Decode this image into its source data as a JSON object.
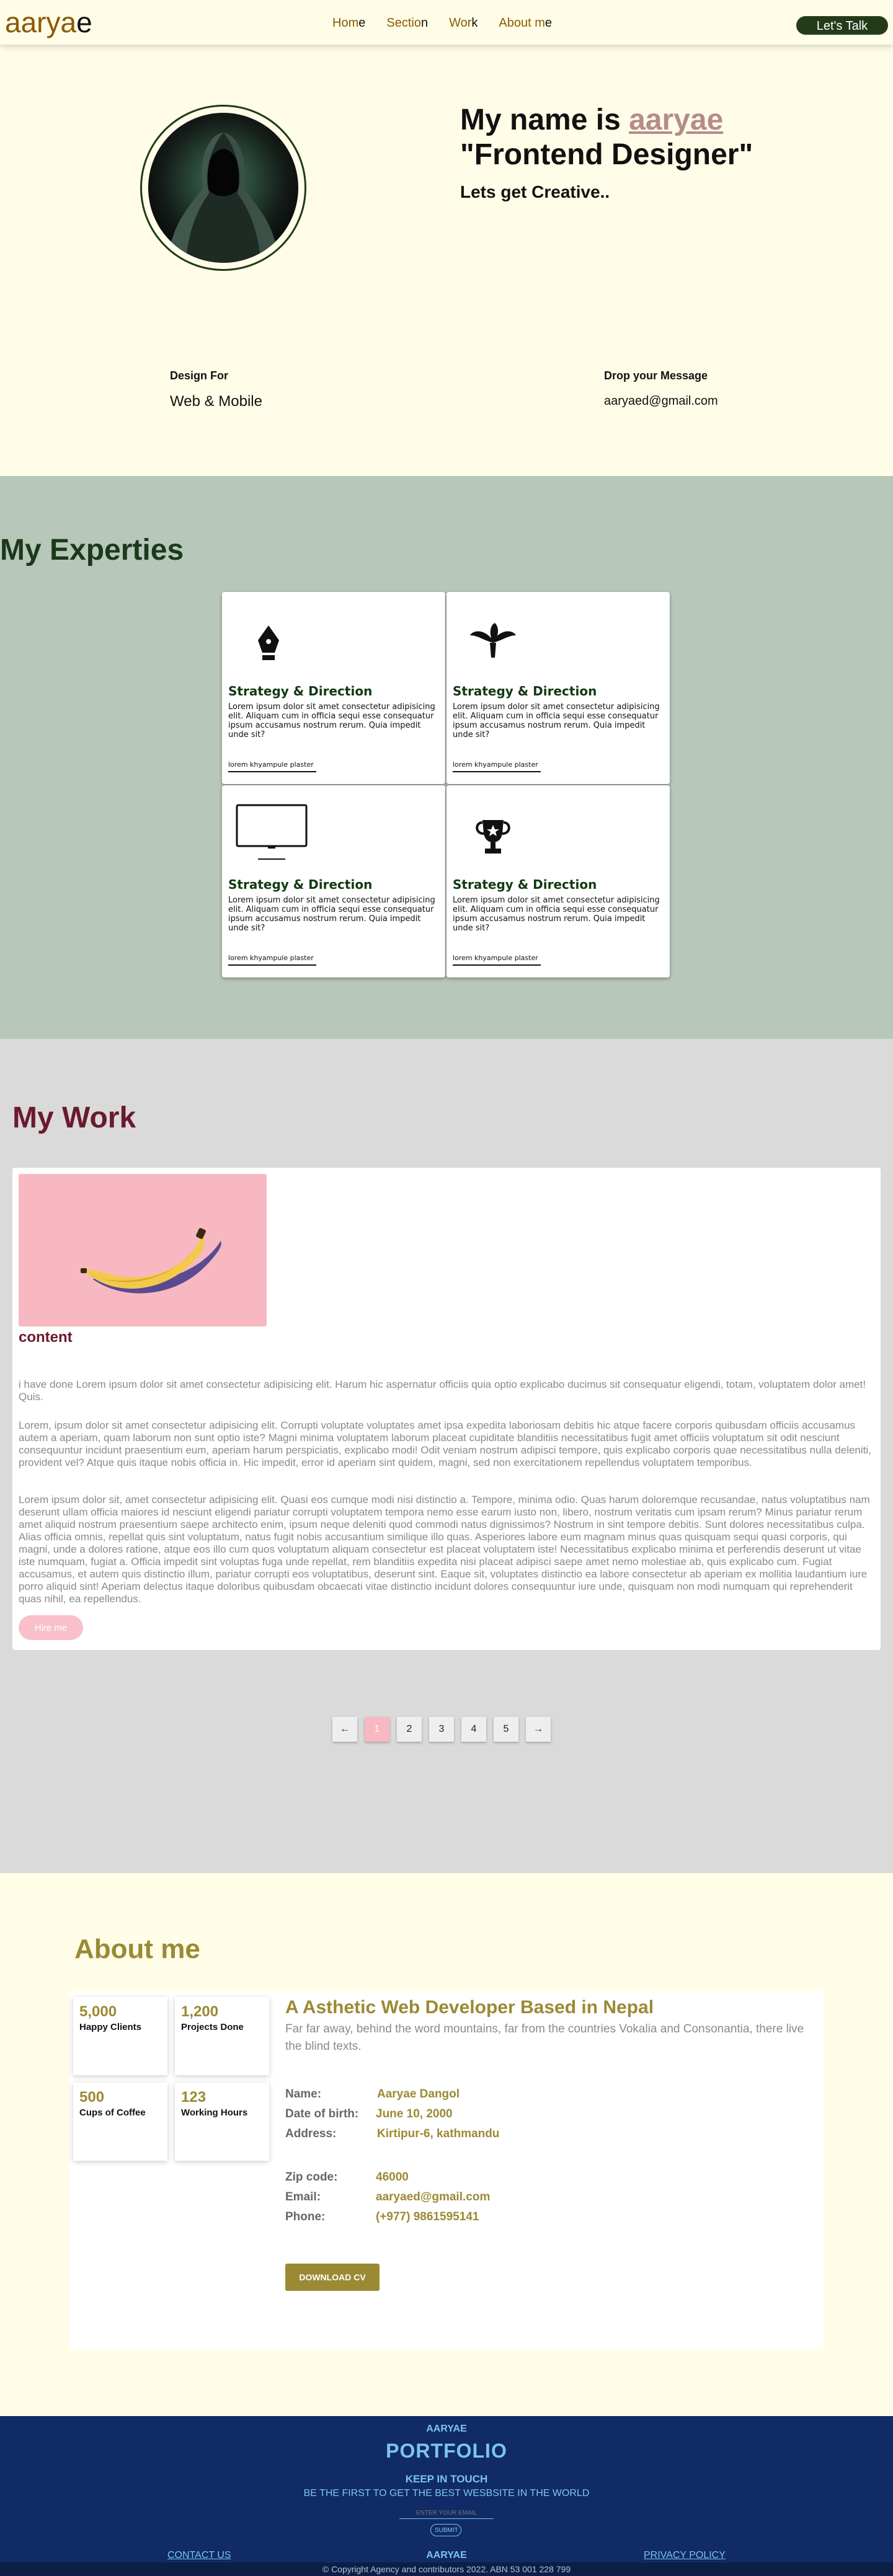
{
  "nav": {
    "logo_main": "aarya",
    "logo_tail": "e",
    "links": [
      {
        "a": "Hom",
        "b": "e"
      },
      {
        "a": "Sectio",
        "b": "n"
      },
      {
        "a": "Wor",
        "b": "k"
      },
      {
        "a": "About m",
        "b": "e"
      }
    ],
    "cta": "Let's Talk"
  },
  "hero": {
    "name_prefix": "My name is ",
    "name": "aaryae",
    "role": "\"Frontend Designer\"",
    "tagline": "Lets get Creative..",
    "design_label": "Design For",
    "design_value": "Web & Mobile",
    "message_label": "Drop your Message",
    "message_value": "aaryaed@gmail.com"
  },
  "expertise": {
    "title": "My Experties",
    "cards": [
      {
        "icon": "pen-nib-icon",
        "title": "Strategy & Direction",
        "text": "Lorem ipsum dolor sit amet consectetur adipisicing elit. Aliquam cum in officia sequi esse consequatur ipsum accusamus nostrum rerum. Quia impedit unde sit?",
        "link": "lorem khyampule plaster"
      },
      {
        "icon": "leaf-icon",
        "title": "Strategy & Direction",
        "text": "Lorem ipsum dolor sit amet consectetur adipisicing elit. Aliquam cum in officia sequi esse consequatur ipsum accusamus nostrum rerum. Quia impedit unde sit?",
        "link": "lorem khyampule plaster"
      },
      {
        "icon": "monitor-icon",
        "title": "Strategy & Direction",
        "text": "Lorem ipsum dolor sit amet consectetur adipisicing elit. Aliquam cum in officia sequi esse consequatur ipsum accusamus nostrum rerum. Quia impedit unde sit?",
        "link": "lorem khyampule plaster"
      },
      {
        "icon": "trophy-icon",
        "title": "Strategy & Direction",
        "text": "Lorem ipsum dolor sit amet consectetur adipisicing elit. Aliquam cum in officia sequi esse consequatur ipsum accusamus nostrum rerum. Quia impedit unde sit?",
        "link": "lorem khyampule plaster"
      }
    ]
  },
  "work": {
    "title": "My Work",
    "card_title": "content",
    "p1": "i have done Lorem ipsum dolor sit amet consectetur adipisicing elit. Harum hic aspernatur officiis quia optio explicabo ducimus sit consequatur eligendi, totam, voluptatem dolor amet! Quis.",
    "p2": "Lorem, ipsum dolor sit amet consectetur adipisicing elit. Corrupti voluptate voluptates amet ipsa expedita laboriosam debitis hic atque facere corporis quibusdam officiis accusamus autem a aperiam, quam laborum non sunt optio iste? Magni minima voluptatem laborum placeat cupiditate blanditiis necessitatibus fugit amet officiis voluptatum sit odit nesciunt consequuntur incidunt praesentium eum, aperiam harum perspiciatis, explicabo modi! Odit veniam nostrum adipisci tempore, quis explicabo corporis quae necessitatibus nulla deleniti, provident vel? Atque quis itaque nobis officia in. Hic impedit, error id aperiam sint quidem, magni, sed non exercitationem repellendus voluptatem temporibus.",
    "p3": "Lorem ipsum dolor sit, amet consectetur adipisicing elit. Quasi eos cumque modi nisi distinctio a. Tempore, minima odio. Quas harum doloremque recusandae, natus voluptatibus nam deserunt ullam officia maiores id nesciunt eligendi pariatur corrupti voluptatem tempora nemo esse earum iusto non, libero, nostrum veritatis cum ipsam rerum? Minus pariatur rerum amet aliquid nostrum praesentium saepe architecto enim, ipsum neque deleniti quod commodi natus dignissimos? Nostrum in sint tempore debitis. Sunt dolores necessitatibus culpa. Alias officia omnis, repellat quis sint voluptatum, natus fugit nobis accusantium similique illo quas. Asperiores labore eum magnam minus quas quisquam sequi quasi corporis, qui magni, unde a dolores ratione, atque eos illo cum quos voluptatum aliquam consectetur est placeat voluptatem iste! Necessitatibus explicabo minima et perferendis deserunt ut vitae iste numquam, fugiat a. Officia impedit sint voluptas fuga unde repellat, rem blanditiis expedita nisi placeat adipisci saepe amet nemo molestiae ab, quis explicabo cum. Fugiat accusamus, et autem quis distinctio illum, pariatur corrupti eos voluptatibus, deserunt sint. Eaque sit, voluptates distinctio ea labore consectetur ab aperiam ex mollitia laudantium iure porro aliquid sint! Aperiam delectus itaque doloribus quibusdam obcaecati vitae distinctio incidunt dolores consequuntur iure unde, quisquam non modi numquam qui reprehenderit quas nihil, ea repellendus.",
    "hire_button": "Hire me",
    "pager": [
      "←",
      "1",
      "2",
      "3",
      "4",
      "5",
      "→"
    ],
    "active_page": "1"
  },
  "about": {
    "title": "About me",
    "stats": [
      {
        "num": "5,000",
        "label": "Happy Clients"
      },
      {
        "num": "1,200",
        "label": "Projects Done"
      },
      {
        "num": "500",
        "label": "Cups of Coffee"
      },
      {
        "num": "123",
        "label": "Working Hours"
      }
    ],
    "heading": "A Asthetic Web Developer Based in Nepal",
    "desc": "Far far away, behind the word mountains, far from the countries Vokalia and Consonantia, there live the blind texts.",
    "rows": [
      {
        "k": "Name:",
        "v": "Aaryae Dangol"
      },
      {
        "k": "Date of birth:",
        "v": "June 10, 2000"
      },
      {
        "k": "Address:",
        "v": "Kirtipur-6, kathmandu"
      },
      {
        "k": "Zip code:",
        "v": "46000"
      },
      {
        "k": "Email:",
        "v": "aaryaed@gmail.com"
      },
      {
        "k": "Phone:",
        "v": "(+977) 9861595141"
      }
    ],
    "cv_button": "DOWNLOAD CV"
  },
  "footer": {
    "brand": "AARYAE",
    "title": "PORTFOLIO",
    "keep": "KEEP IN TOUCH",
    "sub": "BE THE FIRST TO GET THE BEST WESBSITE IN THE WORLD",
    "email_placeholder": "ENTER YOUR EMAIL",
    "submit": "SUBMIT",
    "contact": "CONTACT US",
    "mid": "AARYAE",
    "privacy": "PRIVACY POLICY",
    "copyright": "© Copyright Agency and contributors 2022. ABN 53 001 228 799"
  },
  "colors": {
    "cream": "#fffde7",
    "brown": "#8b5a00",
    "sage": "#b7c7ba",
    "maroon": "#6b1a2e",
    "gold": "#9b8a34",
    "navy": "#102b66",
    "pink": "#f7b8c2"
  }
}
